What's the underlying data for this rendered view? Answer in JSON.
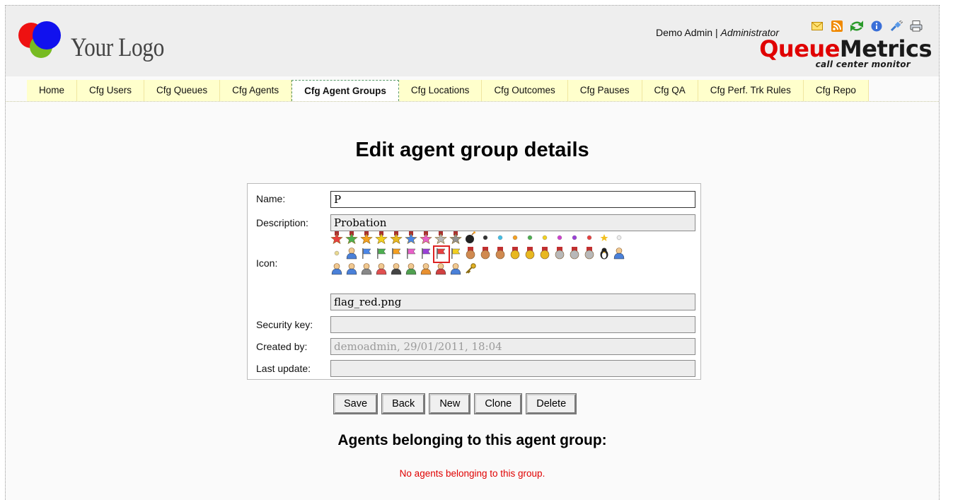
{
  "header": {
    "logo_text": "Your Logo",
    "user_name": "Demo Admin",
    "separator": " | ",
    "user_role": "Administrator",
    "brand_queue": "Queue",
    "brand_metrics": "Metrics",
    "brand_tagline": "call center monitor",
    "tool_icons": [
      "email-icon",
      "rss-icon",
      "refresh-icon",
      "info-icon",
      "plug-icon",
      "print-icon"
    ]
  },
  "tabs": [
    {
      "label": "Home",
      "active": false
    },
    {
      "label": "Cfg Users",
      "active": false
    },
    {
      "label": "Cfg Queues",
      "active": false
    },
    {
      "label": "Cfg Agents",
      "active": false
    },
    {
      "label": "Cfg Agent Groups",
      "active": true
    },
    {
      "label": "Cfg Locations",
      "active": false
    },
    {
      "label": "Cfg Outcomes",
      "active": false
    },
    {
      "label": "Cfg Pauses",
      "active": false
    },
    {
      "label": "Cfg QA",
      "active": false
    },
    {
      "label": "Cfg Perf. Trk Rules",
      "active": false
    },
    {
      "label": "Cfg Repo",
      "active": false
    }
  ],
  "page_title": "Edit agent group details",
  "form": {
    "name_label": "Name:",
    "name_value": "P",
    "description_label": "Description:",
    "description_value": "Probation",
    "icon_label": "Icon:",
    "icon_file": "flag_red.png",
    "security_key_label": "Security key:",
    "security_key_value": "",
    "created_by_label": "Created by:",
    "created_by_value": "demoadmin, 29/01/2011, 18:04",
    "last_update_label": "Last update:",
    "last_update_value": ""
  },
  "icon_grid": {
    "selected_icon": "flag-red-icon",
    "rows": [
      [
        "star-red-icon",
        "star-green-icon",
        "star-orange-icon",
        "star-yellow-icon",
        "star-gold-icon",
        "star-blue-icon",
        "star-pink-icon",
        "star-silver-icon",
        "star-grey-icon",
        "bomb-icon",
        "dot-black-icon",
        "dot-cyan-icon",
        "dot-orange-icon",
        "dot-green-icon",
        "dot-yellow-icon",
        "dot-magenta-icon",
        "dot-purple-icon",
        "dot-red-icon",
        "star-small-icon",
        "dot-white-icon"
      ],
      [
        "dot-beige-icon",
        "user-blue-icon",
        "flag-blue-icon",
        "flag-green-icon",
        "flag-orange-icon",
        "flag-pink-icon",
        "flag-purple-icon",
        "flag-red-icon",
        "flag-yellow-icon",
        "medal-bronze-icon",
        "medal-bronze-2-icon",
        "medal-bronze-3-icon",
        "medal-gold-icon",
        "medal-gold-2-icon",
        "medal-gold-3-icon",
        "medal-silver-icon",
        "medal-silver-2-icon",
        "medal-silver-3-icon",
        "tux-icon",
        "user-icon"
      ],
      [
        "user-group-icon",
        "user-comment-icon",
        "user-gray-icon",
        "user-female-icon",
        "user-suit-icon",
        "user-green-icon",
        "user-orange-icon",
        "user-red-icon",
        "user-blue-2-icon",
        "key-icon"
      ]
    ]
  },
  "buttons": {
    "save": "Save",
    "back": "Back",
    "new": "New",
    "clone": "Clone",
    "delete": "Delete"
  },
  "agents_section": {
    "title": "Agents belonging to this agent group:",
    "empty_message": "No agents belonging to this group."
  }
}
